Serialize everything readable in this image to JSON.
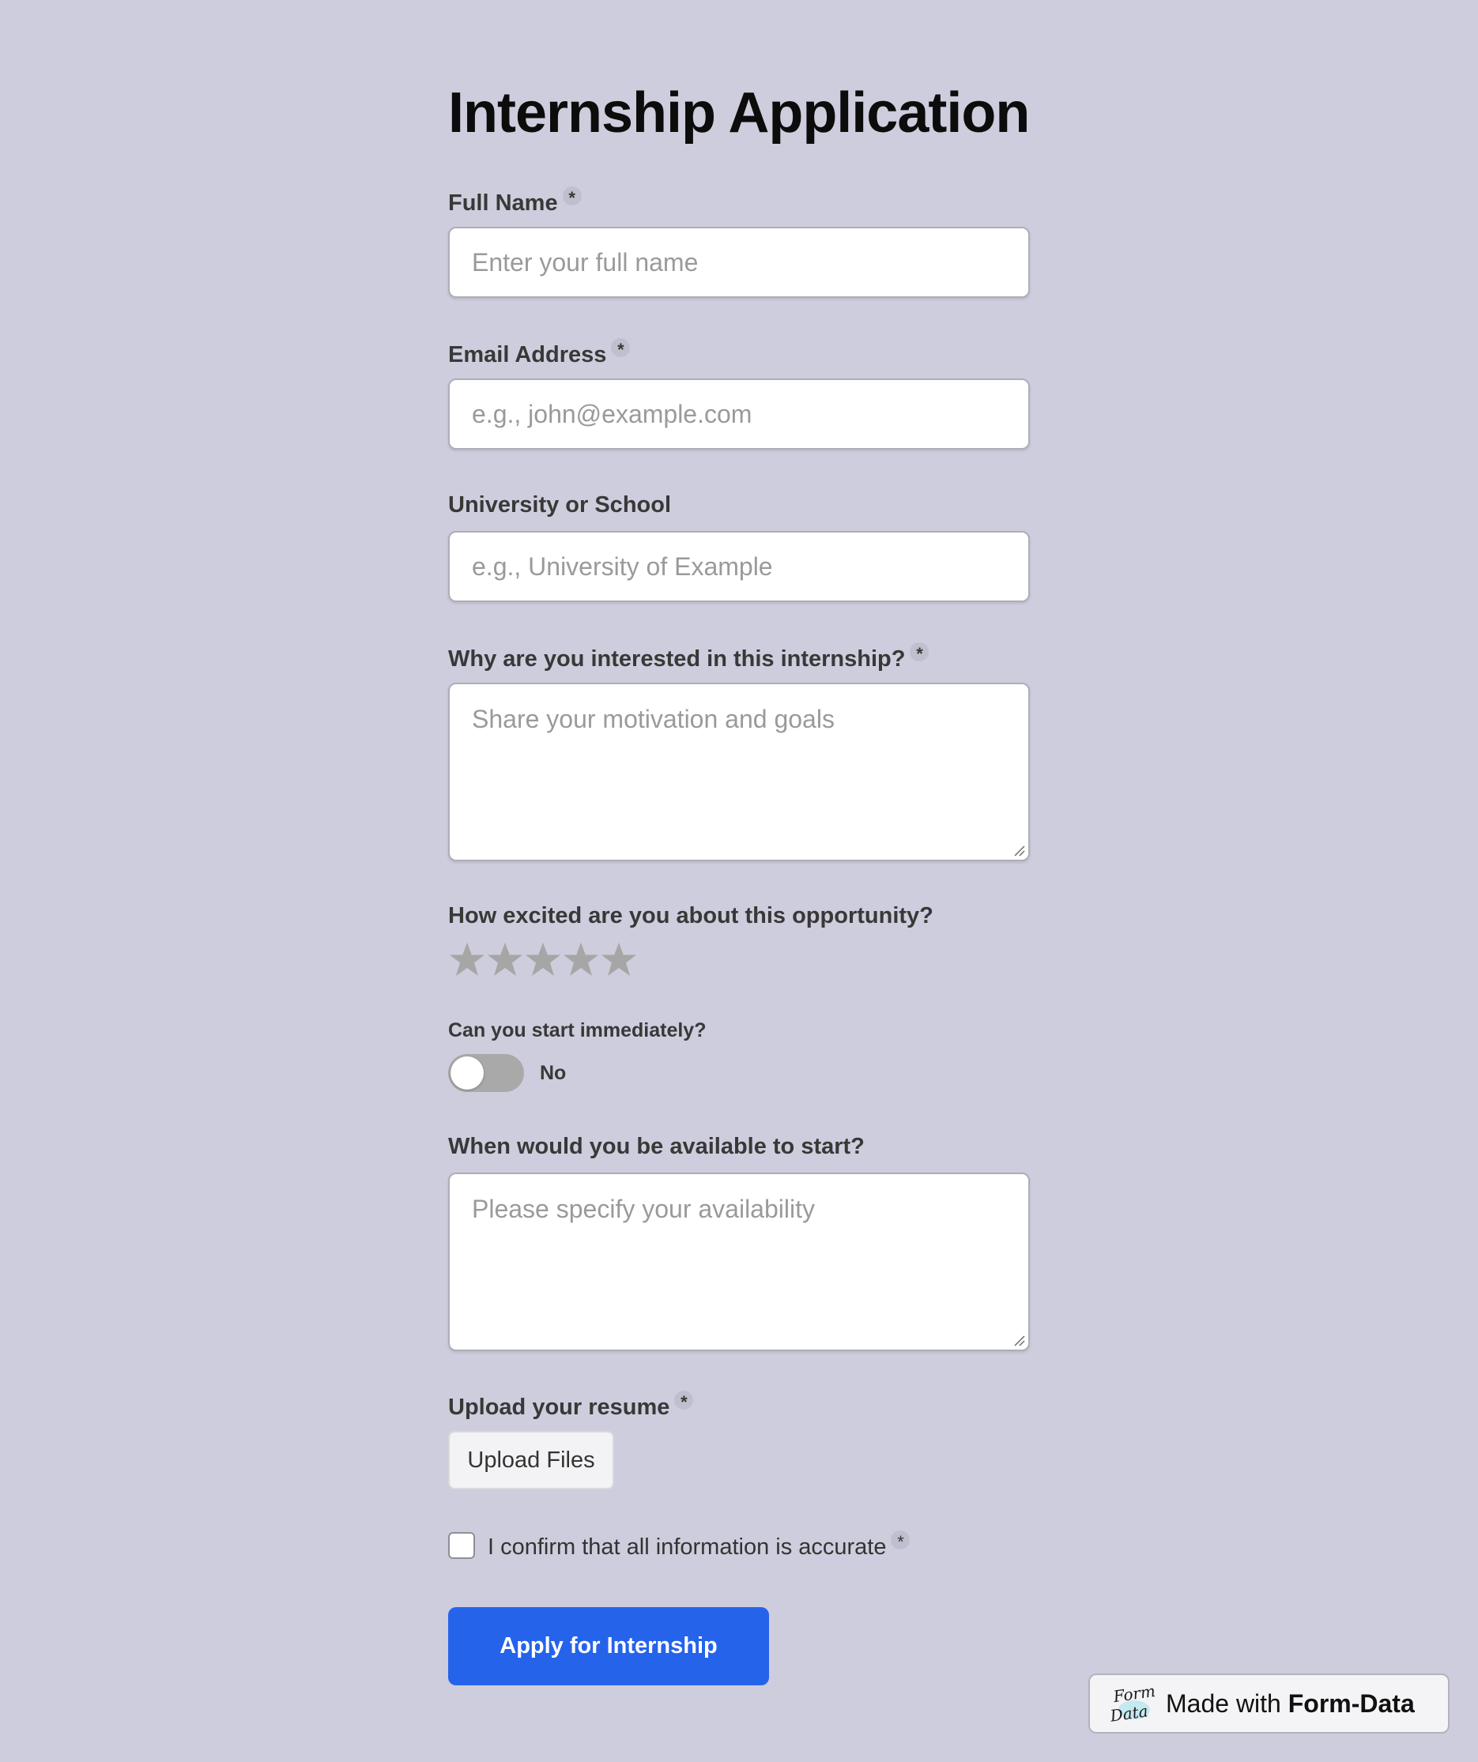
{
  "form": {
    "title": "Internship Application",
    "full_name": {
      "label": "Full Name",
      "required_mark": "*",
      "placeholder": "Enter your full name",
      "value": ""
    },
    "email": {
      "label": "Email Address",
      "required_mark": "*",
      "placeholder": "e.g., john@example.com",
      "value": ""
    },
    "university": {
      "label": "University or School",
      "placeholder": "e.g., University of Example",
      "value": ""
    },
    "interest": {
      "label": "Why are you interested in this internship?",
      "required_mark": "*",
      "placeholder": "Share your motivation and goals",
      "value": ""
    },
    "excitement": {
      "label": "How excited are you about this opportunity?",
      "rating": 0,
      "max_rating": 5
    },
    "start_immediately": {
      "label": "Can you start immediately?",
      "state_label": "No",
      "on": false
    },
    "availability": {
      "label": "When would you be available to start?",
      "placeholder": "Please specify your availability",
      "value": ""
    },
    "resume": {
      "label": "Upload your resume",
      "required_mark": "*",
      "button_label": "Upload Files"
    },
    "confirm": {
      "label": "I confirm that all information is accurate",
      "required_mark": "*",
      "checked": false
    },
    "submit_label": "Apply for Internship"
  },
  "badge": {
    "prefix": "Made with",
    "brand": "Form-Data",
    "logo_text_top": "Form",
    "logo_text_bottom": "Data"
  },
  "colors": {
    "background": "#cdcddd",
    "accent": "#2563eb",
    "star_empty": "#a6a6a6",
    "toggle_off": "#a9a9a9"
  },
  "icons": {
    "star": "star-icon",
    "resize": "resize-grip-icon",
    "logo": "form-data-logo-icon"
  }
}
